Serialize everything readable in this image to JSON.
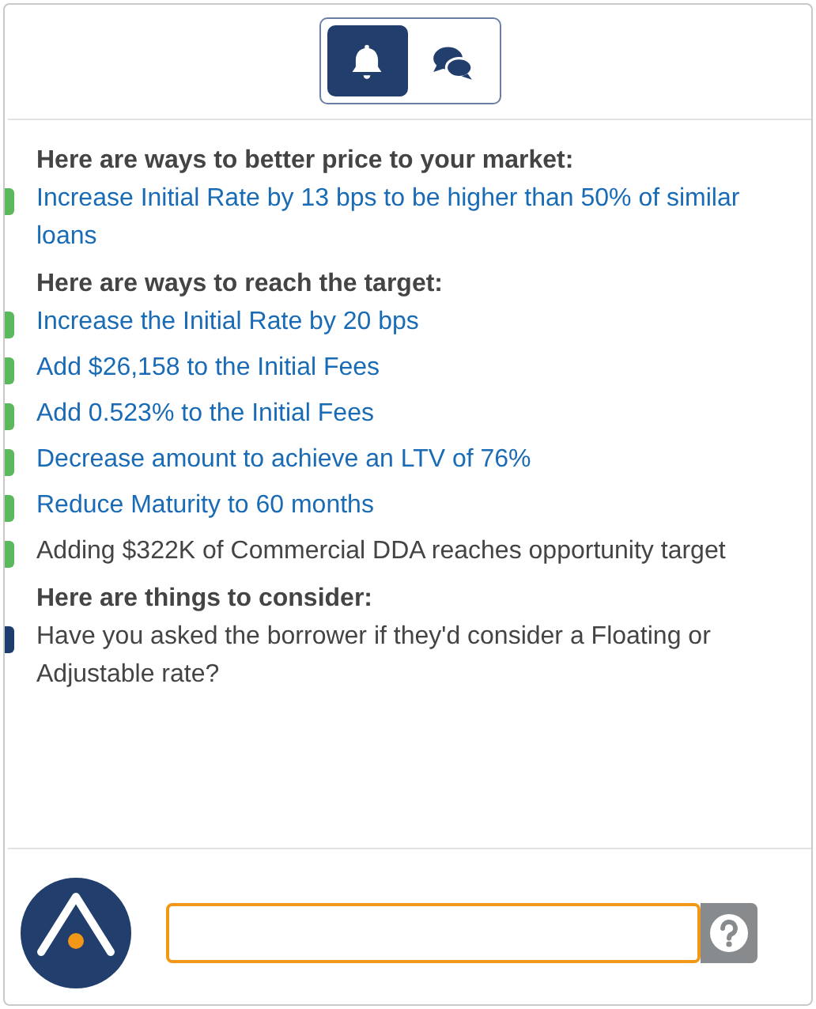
{
  "tabs": [
    {
      "kind": "bell",
      "selected": true
    },
    {
      "kind": "chat",
      "selected": false
    }
  ],
  "sections": [
    {
      "heading": "Here are ways to better price to your market:",
      "items": [
        {
          "text": "Increase Initial Rate by 13 bps to be higher than 50% of similar loans",
          "kind": "link",
          "color": "#5cb85c"
        }
      ]
    },
    {
      "heading": "Here are ways to reach the target:",
      "items": [
        {
          "text": "Increase the Initial Rate by 20 bps",
          "kind": "link",
          "color": "#5cb85c"
        },
        {
          "text": "Add $26,158 to the Initial Fees",
          "kind": "link",
          "color": "#5cb85c"
        },
        {
          "text": "Add 0.523% to the Initial Fees",
          "kind": "link",
          "color": "#5cb85c"
        },
        {
          "text": "Decrease amount to achieve an LTV of 76%",
          "kind": "link",
          "color": "#5cb85c"
        },
        {
          "text": "Reduce Maturity to 60 months",
          "kind": "link",
          "color": "#5cb85c"
        },
        {
          "text": "Adding $322K of Commercial DDA reaches opportunity target",
          "kind": "text",
          "color": "#5cb85c"
        }
      ]
    },
    {
      "heading": "Here are things to consider:",
      "items": [
        {
          "text": "Have you asked the borrower if they'd consider a Floating or Adjustable rate?",
          "kind": "text",
          "color": "#1f3c6e"
        }
      ]
    }
  ]
}
